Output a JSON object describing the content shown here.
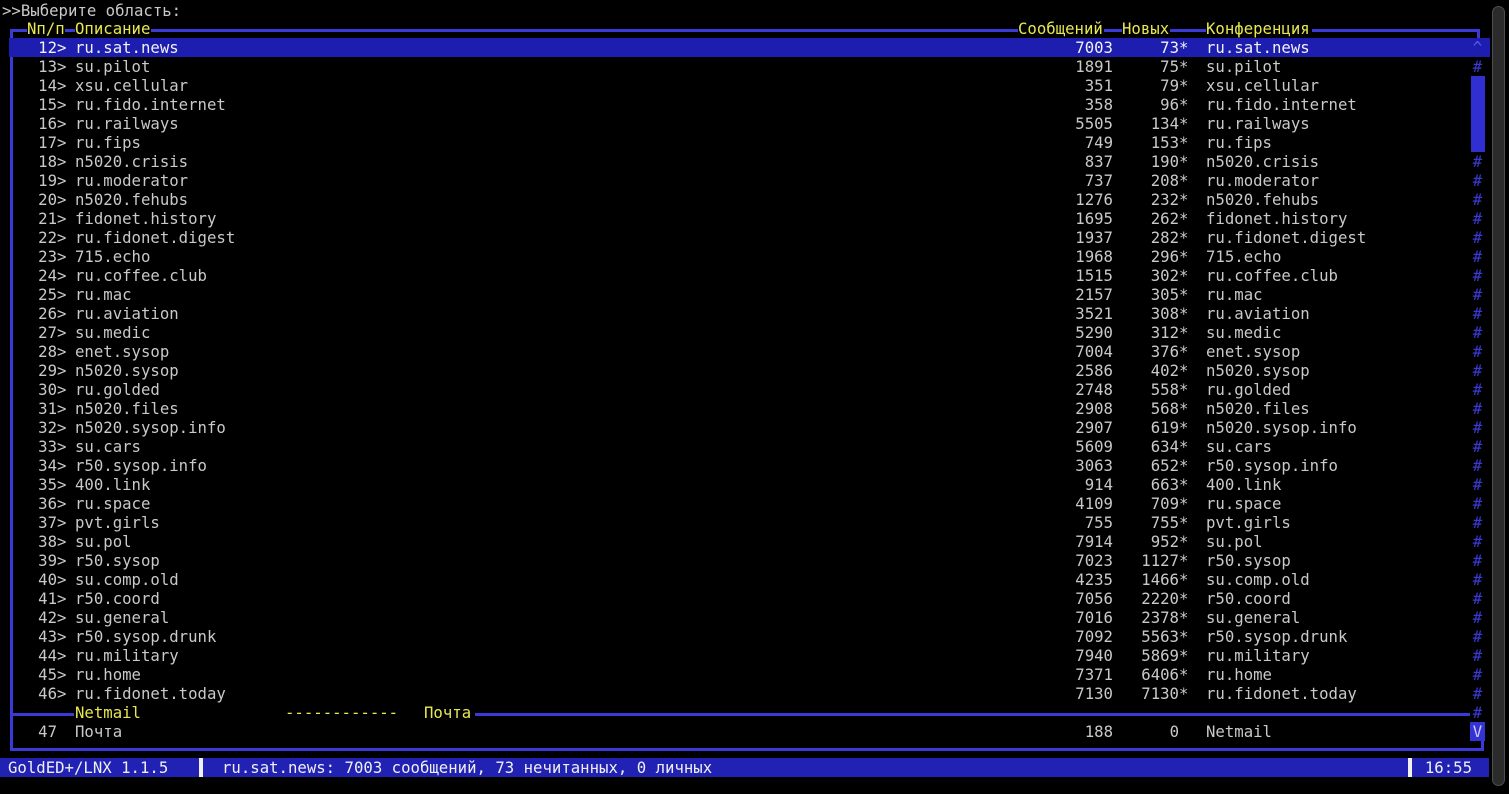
{
  "prompt": ">>Выберите область:",
  "header": {
    "num": "Nп/п",
    "desc": "Описание",
    "msgs": "Сообщений",
    "new": "Новых",
    "conf": "Конференция"
  },
  "areas": [
    {
      "n": "12",
      "sel": true,
      "desc": "ru.sat.news",
      "msgs": "7003",
      "new": "73",
      "star": true,
      "conf": "ru.sat.news"
    },
    {
      "n": "13",
      "desc": "su.pilot",
      "msgs": "1891",
      "new": "75",
      "star": true,
      "conf": "su.pilot"
    },
    {
      "n": "14",
      "desc": "xsu.cellular",
      "msgs": "351",
      "new": "79",
      "star": true,
      "conf": "xsu.cellular"
    },
    {
      "n": "15",
      "desc": "ru.fido.internet",
      "msgs": "358",
      "new": "96",
      "star": true,
      "conf": "ru.fido.internet"
    },
    {
      "n": "16",
      "desc": "ru.railways",
      "msgs": "5505",
      "new": "134",
      "star": true,
      "conf": "ru.railways"
    },
    {
      "n": "17",
      "desc": "ru.fips",
      "msgs": "749",
      "new": "153",
      "star": true,
      "conf": "ru.fips"
    },
    {
      "n": "18",
      "desc": "n5020.crisis",
      "msgs": "837",
      "new": "190",
      "star": true,
      "conf": "n5020.crisis"
    },
    {
      "n": "19",
      "desc": "ru.moderator",
      "msgs": "737",
      "new": "208",
      "star": true,
      "conf": "ru.moderator"
    },
    {
      "n": "20",
      "desc": "n5020.fehubs",
      "msgs": "1276",
      "new": "232",
      "star": true,
      "conf": "n5020.fehubs"
    },
    {
      "n": "21",
      "desc": "fidonet.history",
      "msgs": "1695",
      "new": "262",
      "star": true,
      "conf": "fidonet.history"
    },
    {
      "n": "22",
      "desc": "ru.fidonet.digest",
      "msgs": "1937",
      "new": "282",
      "star": true,
      "conf": "ru.fidonet.digest"
    },
    {
      "n": "23",
      "desc": "715.echo",
      "msgs": "1968",
      "new": "296",
      "star": true,
      "conf": "715.echo"
    },
    {
      "n": "24",
      "desc": "ru.coffee.club",
      "msgs": "1515",
      "new": "302",
      "star": true,
      "conf": "ru.coffee.club"
    },
    {
      "n": "25",
      "desc": "ru.mac",
      "msgs": "2157",
      "new": "305",
      "star": true,
      "conf": "ru.mac"
    },
    {
      "n": "26",
      "desc": "ru.aviation",
      "msgs": "3521",
      "new": "308",
      "star": true,
      "conf": "ru.aviation"
    },
    {
      "n": "27",
      "desc": "su.medic",
      "msgs": "5290",
      "new": "312",
      "star": true,
      "conf": "su.medic"
    },
    {
      "n": "28",
      "desc": "enet.sysop",
      "msgs": "7004",
      "new": "376",
      "star": true,
      "conf": "enet.sysop"
    },
    {
      "n": "29",
      "desc": "n5020.sysop",
      "msgs": "2586",
      "new": "402",
      "star": true,
      "conf": "n5020.sysop"
    },
    {
      "n": "30",
      "desc": "ru.golded",
      "msgs": "2748",
      "new": "558",
      "star": true,
      "conf": "ru.golded"
    },
    {
      "n": "31",
      "desc": "n5020.files",
      "msgs": "2908",
      "new": "568",
      "star": true,
      "conf": "n5020.files"
    },
    {
      "n": "32",
      "desc": "n5020.sysop.info",
      "msgs": "2907",
      "new": "619",
      "star": true,
      "conf": "n5020.sysop.info"
    },
    {
      "n": "33",
      "desc": "su.cars",
      "msgs": "5609",
      "new": "634",
      "star": true,
      "conf": "su.cars"
    },
    {
      "n": "34",
      "desc": "r50.sysop.info",
      "msgs": "3063",
      "new": "652",
      "star": true,
      "conf": "r50.sysop.info"
    },
    {
      "n": "35",
      "desc": "400.link",
      "msgs": "914",
      "new": "663",
      "star": true,
      "conf": "400.link"
    },
    {
      "n": "36",
      "desc": "ru.space",
      "msgs": "4109",
      "new": "709",
      "star": true,
      "conf": "ru.space"
    },
    {
      "n": "37",
      "desc": "pvt.girls",
      "msgs": "755",
      "new": "755",
      "star": true,
      "conf": "pvt.girls"
    },
    {
      "n": "38",
      "desc": "su.pol",
      "msgs": "7914",
      "new": "952",
      "star": true,
      "conf": "su.pol"
    },
    {
      "n": "39",
      "desc": "r50.sysop",
      "msgs": "7023",
      "new": "1127",
      "star": true,
      "conf": "r50.sysop"
    },
    {
      "n": "40",
      "desc": "su.comp.old",
      "msgs": "4235",
      "new": "1466",
      "star": true,
      "conf": "su.comp.old"
    },
    {
      "n": "41",
      "desc": "r50.coord",
      "msgs": "7056",
      "new": "2220",
      "star": true,
      "conf": "r50.coord"
    },
    {
      "n": "42",
      "desc": "su.general",
      "msgs": "7016",
      "new": "2378",
      "star": true,
      "conf": "su.general"
    },
    {
      "n": "43",
      "desc": "r50.sysop.drunk",
      "msgs": "7092",
      "new": "5563",
      "star": true,
      "conf": "r50.sysop.drunk"
    },
    {
      "n": "44",
      "desc": "ru.military",
      "msgs": "7940",
      "new": "5869",
      "star": true,
      "conf": "ru.military"
    },
    {
      "n": "45",
      "desc": "ru.home",
      "msgs": "7371",
      "new": "6406",
      "star": true,
      "conf": "ru.home"
    },
    {
      "n": "46",
      "desc": "ru.fidonet.today",
      "msgs": "7130",
      "new": "7130",
      "star": true,
      "conf": "ru.fidonet.today"
    }
  ],
  "netmail_separator": {
    "label_left": "Netmail",
    "dashes": "------------",
    "label_right": "Почта"
  },
  "netmail_area": {
    "n": "47",
    "desc": "Почта",
    "msgs": "188",
    "new": "0",
    "star": false,
    "conf": "Netmail"
  },
  "scrollbar": {
    "up": "^",
    "down": "V",
    "track": "#"
  },
  "statusbar": {
    "app": "GoldED+/LNX 1.1.5",
    "info": "ru.sat.news: 7003 сообщений, 73 нечитанных, 0 личных",
    "clock": "16:55"
  },
  "colors": {
    "border_blue": "#3a3ad6",
    "selection_bg": "#1d1db0",
    "header_yellow": "#e8e852",
    "list_text": "#c9c9c9",
    "status_bg": "#2121b4",
    "status_text": "#f0f0f0"
  }
}
